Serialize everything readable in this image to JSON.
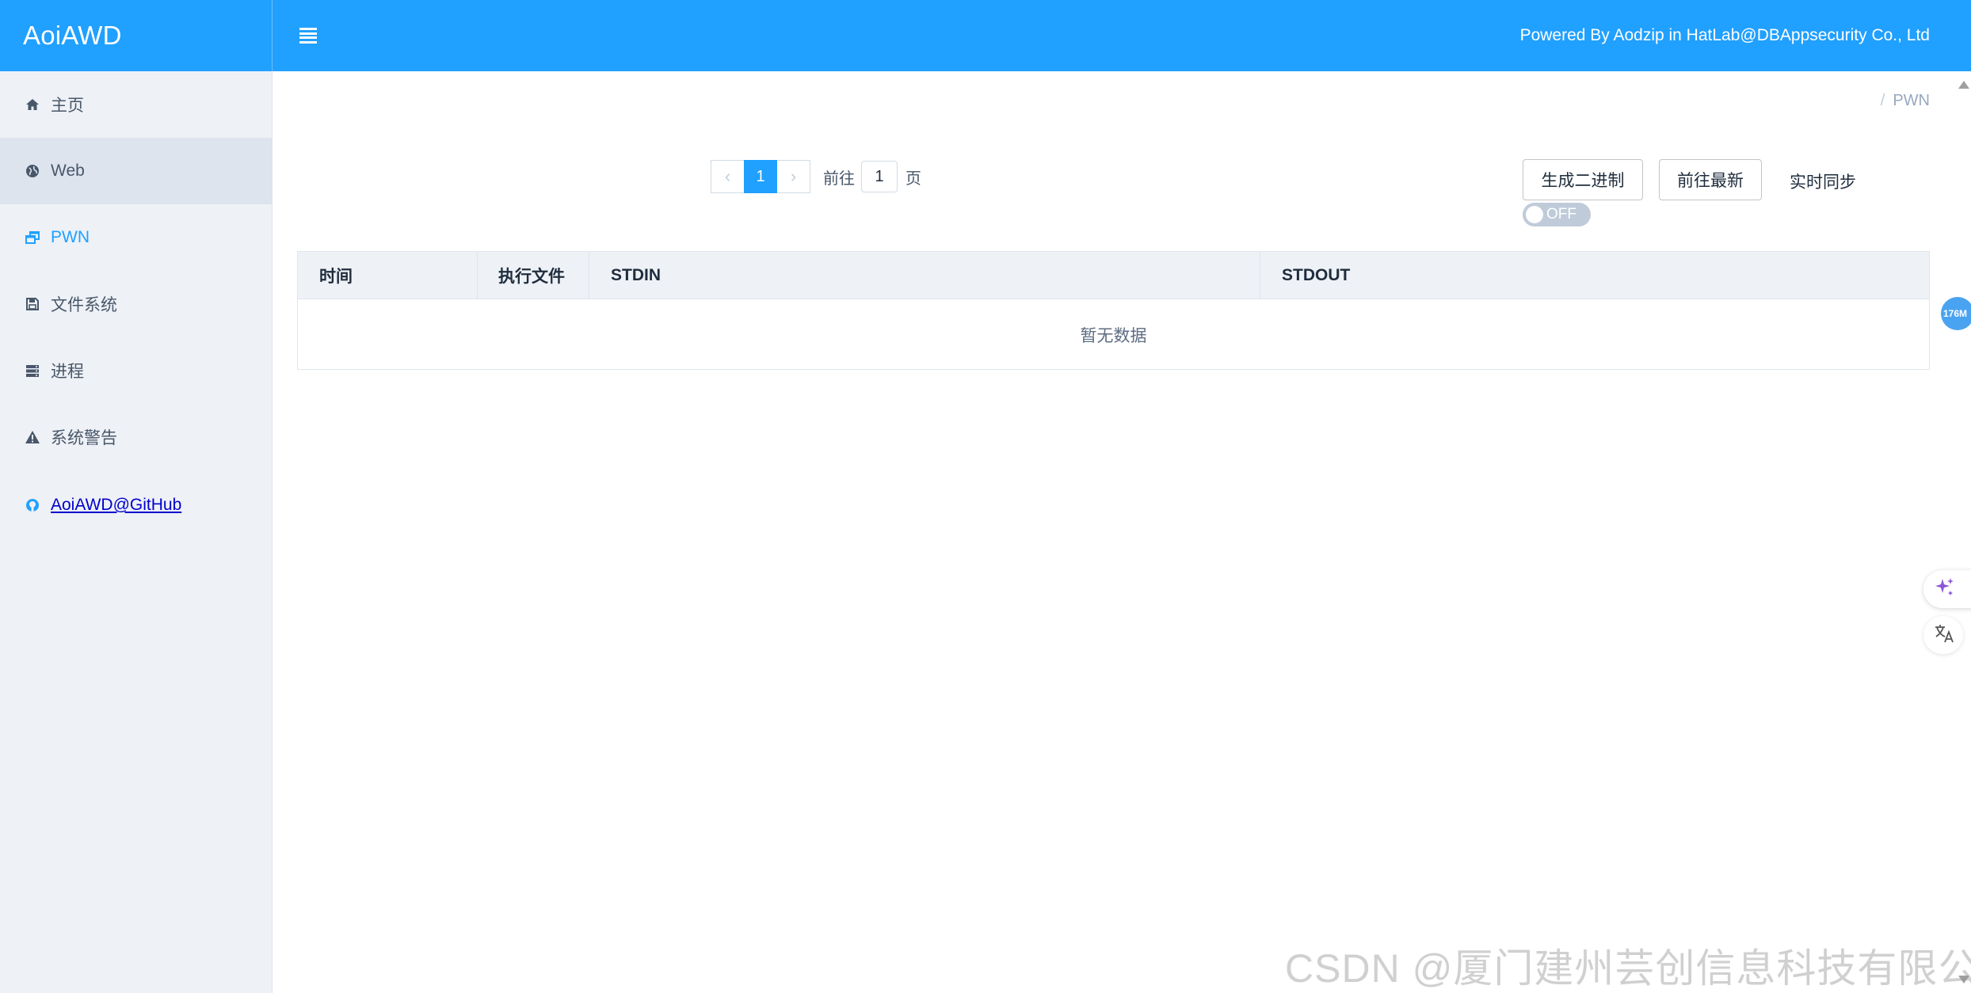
{
  "header": {
    "brand": "AoiAWD",
    "powered_by": "Powered By Aodzip in HatLab@DBAppsecurity Co., Ltd"
  },
  "sidebar": {
    "items": [
      {
        "label": "主页",
        "icon": "home-icon"
      },
      {
        "label": "Web",
        "icon": "globe-icon"
      },
      {
        "label": "PWN",
        "icon": "windows-icon"
      },
      {
        "label": "文件系统",
        "icon": "floppy-icon"
      },
      {
        "label": "进程",
        "icon": "server-icon"
      },
      {
        "label": "系统警告",
        "icon": "warning-icon"
      },
      {
        "label": "AoiAWD@GitHub",
        "icon": "github-icon"
      }
    ]
  },
  "breadcrumb": {
    "separator": "/",
    "current": "PWN"
  },
  "pagination": {
    "current_page": "1",
    "goto_label": "前往",
    "goto_value": "1",
    "page_suffix": "页",
    "prev_symbol": "‹",
    "next_symbol": "›"
  },
  "actions": {
    "generate_binary": "生成二进制",
    "goto_latest": "前往最新",
    "realtime_sync": "实时同步",
    "switch_state": "OFF"
  },
  "table": {
    "columns": [
      "时间",
      "执行文件",
      "STDIN",
      "STDOUT"
    ],
    "empty_text": "暂无数据"
  },
  "widgets": {
    "memory_badge": "176M"
  },
  "watermark": "CSDN @厦门建州芸创信息科技有限公司",
  "colors": {
    "primary": "#20a0ff",
    "sidebar_bg": "#eef1f6",
    "table_header_bg": "#eef1f6",
    "switch_off": "#bfcbd9"
  }
}
